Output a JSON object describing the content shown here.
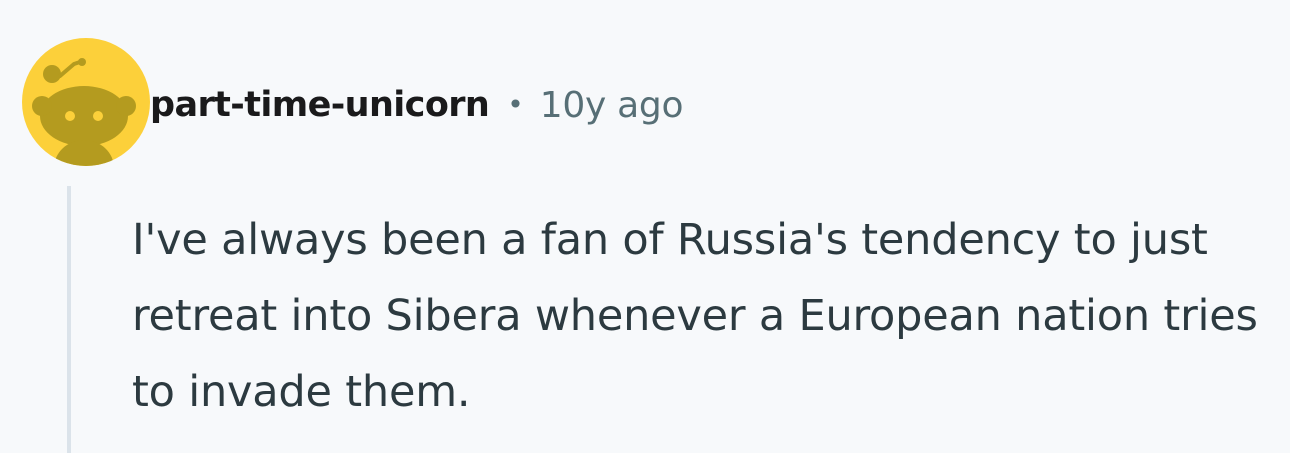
{
  "colors": {
    "background": "#f7f9fb",
    "avatar_bg": "#fcd03a",
    "avatar_snoo": "#b49b1f",
    "meta_text": "#576f76",
    "thread_line": "#dbe3ea",
    "body_text": "#2c3a40"
  },
  "comment": {
    "author": "part-time-unicorn",
    "separator": "•",
    "age": "10y ago",
    "avatar_icon": "snoo-avatar-icon",
    "body": "I've always been a fan of Russia's tendency to just retreat into Sibera whenever a European nation tries to invade them."
  }
}
